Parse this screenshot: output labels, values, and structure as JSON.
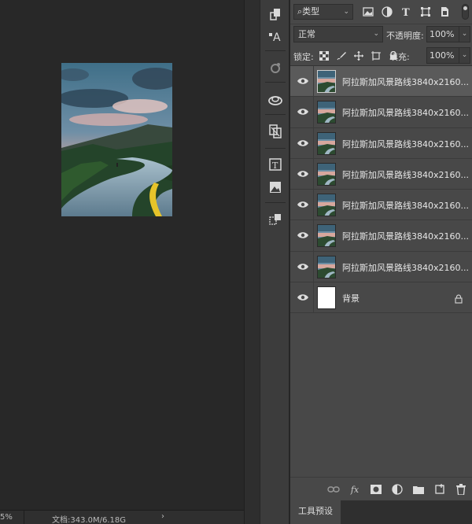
{
  "canvas": {
    "status": {
      "zoom": "5%",
      "doc": "文档:343.0M/6.18G",
      "arrow": "›"
    }
  },
  "layers_panel": {
    "filter": {
      "label": "类型",
      "chevron": "⌄"
    },
    "blend": {
      "mode": "正常",
      "chevron": "⌄",
      "opacity_label": "不透明度:",
      "opacity_value": "100%"
    },
    "lock": {
      "label": "锁定:",
      "fill_label": "填充:",
      "fill_value": "100%"
    },
    "layers": [
      {
        "name": "阿拉斯加风景路线3840x2160...",
        "selected": true
      },
      {
        "name": "阿拉斯加风景路线3840x2160..."
      },
      {
        "name": "阿拉斯加风景路线3840x2160..."
      },
      {
        "name": "阿拉斯加风景路线3840x2160..."
      },
      {
        "name": "阿拉斯加风景路线3840x2160..."
      },
      {
        "name": "阿拉斯加风景路线3840x2160..."
      },
      {
        "name": "阿拉斯加风景路线3840x2160..."
      },
      {
        "name": "背景",
        "locked": true
      }
    ],
    "footer_icons": [
      "link-icon",
      "fx-icon",
      "mask-icon",
      "adjustment-icon",
      "folder-icon",
      "new-layer-icon",
      "trash-icon"
    ]
  },
  "tabs": {
    "presets": "工具预设"
  }
}
